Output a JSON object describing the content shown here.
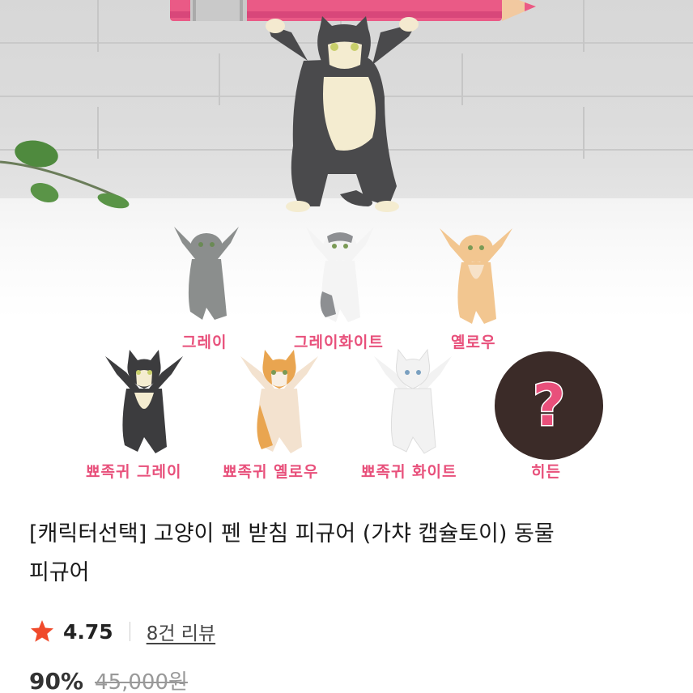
{
  "product_image": {
    "icon": "cat-figure-photo",
    "variants": [
      {
        "label": "그레이",
        "color": "#8b8e8d"
      },
      {
        "label": "그레이화이트",
        "color": "#ffffff"
      },
      {
        "label": "옐로우",
        "color": "#f2c690"
      },
      {
        "label": "뾰족귀 그레이",
        "color": "#3c3c3e"
      },
      {
        "label": "뾰족귀 옐로우",
        "color": "#e9a550"
      },
      {
        "label": "뾰족귀 화이트",
        "color": "#f2f2f2"
      },
      {
        "label": "히든",
        "mark": "?"
      }
    ],
    "label_color": "#e8507b",
    "pencil_color": "#ea5a86"
  },
  "product": {
    "title_line1": "[캐릭터선택] 고양이 펜 받침 피규어 (가챠 캡슐토이) 동물",
    "title_line2": "피규어",
    "rating": "4.75",
    "review_count": "8건 리뷰",
    "discount": "90%",
    "original_price": "45,000원",
    "star_color": "#f04a2b"
  }
}
